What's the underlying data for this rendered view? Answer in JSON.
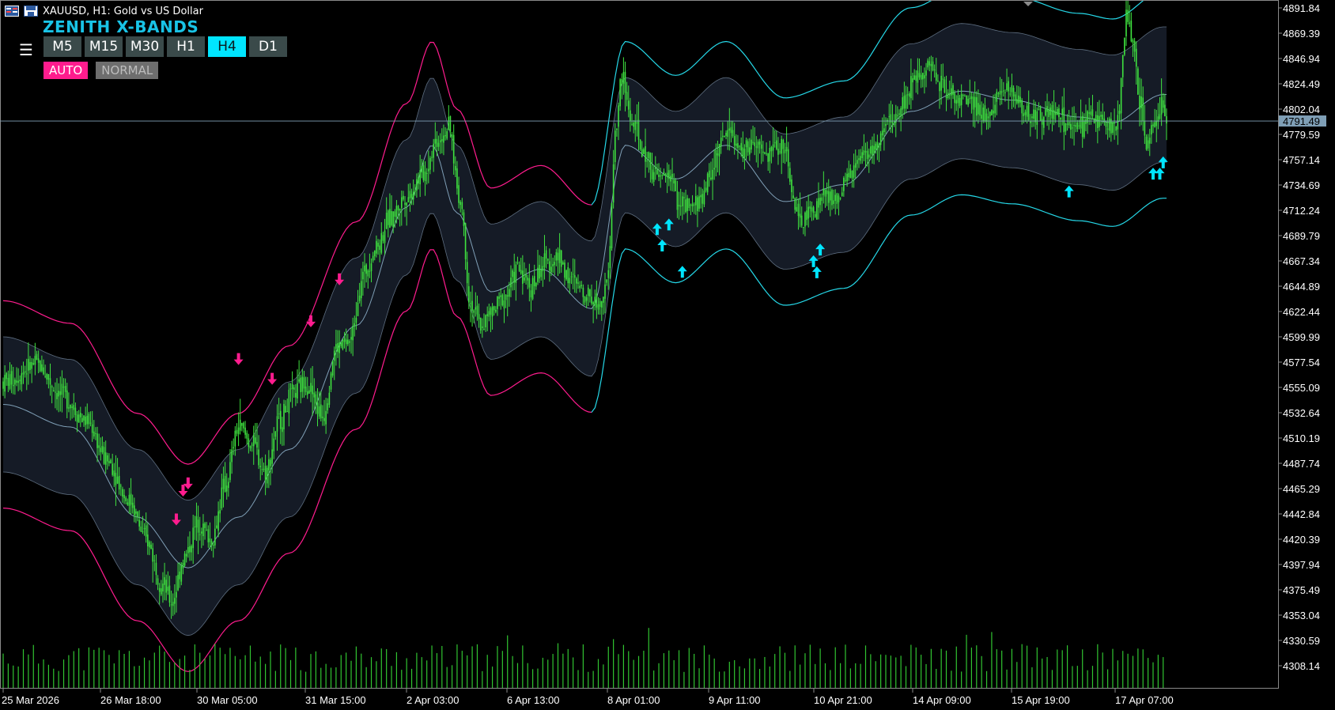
{
  "window": {
    "title": "XAUUSD, H1:  Gold vs US Dollar",
    "icons": [
      "chart-window-icon",
      "indicator-save-icon"
    ]
  },
  "indicator": {
    "name": "ZENITH X-BANDS",
    "menu_icon": "hamburger-menu-icon",
    "timeframes": [
      "M5",
      "M15",
      "M30",
      "H1",
      "H4",
      "D1"
    ],
    "active_timeframe": "H4",
    "modes": {
      "auto": "AUTO",
      "normal": "NORMAL"
    }
  },
  "colors": {
    "background": "#000000",
    "candle": "#3fe33f",
    "volume": "#31c431",
    "band_fill": "#151b26",
    "mid_line": "#7f9fb6",
    "outer_bull": "#25d8e8",
    "outer_bear": "#ff1c8e",
    "arrow_up": "#00e5ff",
    "arrow_down": "#ff1c8e",
    "price_line": "#7f9fb6"
  },
  "chart_data": {
    "type": "candlestick",
    "symbol": "XAUUSD",
    "timeframe": "H1",
    "y_ticks": [
      "4891.84",
      "4869.39",
      "4846.94",
      "4824.49",
      "4802.04",
      "4779.59",
      "4757.14",
      "4734.69",
      "4712.24",
      "4689.79",
      "4667.34",
      "4644.89",
      "4622.44",
      "4599.99",
      "4577.54",
      "4555.09",
      "4532.64",
      "4510.19",
      "4487.74",
      "4465.29",
      "4442.84",
      "4420.39",
      "4397.94",
      "4375.49",
      "4353.04",
      "4330.59",
      "4308.14"
    ],
    "x_ticks": [
      "25 Mar 2026",
      "26 Mar 18:00",
      "30 Mar 05:00",
      "31 Mar 15:00",
      "2 Apr 03:00",
      "6 Apr 13:00",
      "8 Apr 01:00",
      "9 Apr 11:00",
      "10 Apr 21:00",
      "14 Apr 09:00",
      "15 Apr 19:00",
      "17 Apr 07:00"
    ],
    "current_price": "4791.49",
    "ylim": [
      4300,
      4895
    ],
    "price_path": [
      [
        0,
        4560
      ],
      [
        20,
        4575
      ],
      [
        35,
        4548
      ],
      [
        50,
        4525
      ],
      [
        62,
        4490
      ],
      [
        75,
        4455
      ],
      [
        85,
        4420
      ],
      [
        95,
        4380
      ],
      [
        100,
        4365
      ],
      [
        108,
        4405
      ],
      [
        116,
        4435
      ],
      [
        124,
        4420
      ],
      [
        132,
        4468
      ],
      [
        140,
        4520
      ],
      [
        148,
        4505
      ],
      [
        156,
        4480
      ],
      [
        164,
        4525
      ],
      [
        172,
        4548
      ],
      [
        180,
        4560
      ],
      [
        190,
        4530
      ],
      [
        198,
        4590
      ],
      [
        206,
        4595
      ],
      [
        214,
        4655
      ],
      [
        222,
        4680
      ],
      [
        230,
        4705
      ],
      [
        240,
        4725
      ],
      [
        250,
        4745
      ],
      [
        258,
        4775
      ],
      [
        265,
        4785
      ],
      [
        272,
        4720
      ],
      [
        278,
        4630
      ],
      [
        284,
        4610
      ],
      [
        290,
        4620
      ],
      [
        298,
        4635
      ],
      [
        306,
        4660
      ],
      [
        314,
        4645
      ],
      [
        322,
        4665
      ],
      [
        330,
        4670
      ],
      [
        338,
        4650
      ],
      [
        346,
        4640
      ],
      [
        354,
        4630
      ],
      [
        360,
        4655
      ],
      [
        364,
        4780
      ],
      [
        368,
        4830
      ],
      [
        374,
        4790
      ],
      [
        382,
        4760
      ],
      [
        390,
        4740
      ],
      [
        396,
        4745
      ],
      [
        402,
        4720
      ],
      [
        408,
        4712
      ],
      [
        414,
        4720
      ],
      [
        420,
        4740
      ],
      [
        426,
        4770
      ],
      [
        432,
        4785
      ],
      [
        438,
        4765
      ],
      [
        446,
        4770
      ],
      [
        454,
        4760
      ],
      [
        460,
        4770
      ],
      [
        466,
        4765
      ],
      [
        470,
        4720
      ],
      [
        474,
        4700
      ],
      [
        480,
        4710
      ],
      [
        488,
        4725
      ],
      [
        496,
        4720
      ],
      [
        504,
        4745
      ],
      [
        512,
        4760
      ],
      [
        520,
        4770
      ],
      [
        528,
        4790
      ],
      [
        536,
        4810
      ],
      [
        544,
        4835
      ],
      [
        552,
        4840
      ],
      [
        560,
        4820
      ],
      [
        568,
        4812
      ],
      [
        576,
        4805
      ],
      [
        584,
        4795
      ],
      [
        592,
        4815
      ],
      [
        600,
        4818
      ],
      [
        608,
        4800
      ],
      [
        616,
        4795
      ],
      [
        624,
        4800
      ],
      [
        632,
        4790
      ],
      [
        640,
        4785
      ],
      [
        648,
        4795
      ],
      [
        656,
        4790
      ],
      [
        662,
        4785
      ],
      [
        668,
        4880
      ],
      [
        672,
        4860
      ],
      [
        676,
        4810
      ],
      [
        680,
        4770
      ],
      [
        684,
        4790
      ],
      [
        688,
        4805
      ],
      [
        692,
        4795
      ]
    ],
    "bands": {
      "center": [
        [
          0,
          4540
        ],
        [
          40,
          4520
        ],
        [
          80,
          4440
        ],
        [
          110,
          4395
        ],
        [
          140,
          4440
        ],
        [
          170,
          4500
        ],
        [
          210,
          4610
        ],
        [
          240,
          4715
        ],
        [
          255,
          4770
        ],
        [
          270,
          4710
        ],
        [
          290,
          4640
        ],
        [
          320,
          4660
        ],
        [
          350,
          4625
        ],
        [
          370,
          4770
        ],
        [
          400,
          4740
        ],
        [
          430,
          4770
        ],
        [
          465,
          4720
        ],
        [
          500,
          4735
        ],
        [
          540,
          4800
        ],
        [
          570,
          4818
        ],
        [
          600,
          4810
        ],
        [
          640,
          4795
        ],
        [
          660,
          4790
        ],
        [
          690,
          4815
        ]
      ],
      "inner_half_width": 60,
      "outer_half_width": 92
    },
    "arrows_down_x": [
      103,
      107,
      110,
      140,
      160,
      183,
      200
    ],
    "arrows_up_x": [
      389,
      392,
      396,
      404,
      482,
      484,
      486,
      634,
      684,
      688,
      690
    ],
    "volume_max": 100
  }
}
